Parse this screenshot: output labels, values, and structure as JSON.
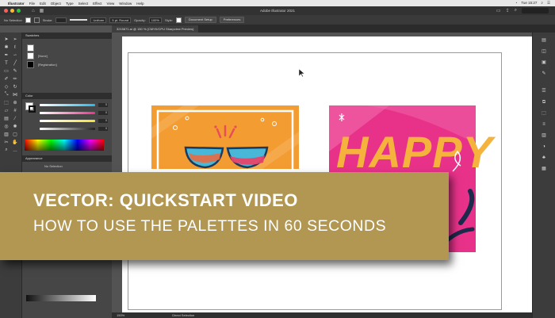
{
  "menubar": {
    "items": [
      "Illustrator",
      "File",
      "Edit",
      "Object",
      "Type",
      "Select",
      "Effect",
      "View",
      "Window",
      "Help"
    ],
    "clock": "Tue 15:27"
  },
  "titlebar": {
    "title": "Adobe Illustrator 2021"
  },
  "controlbar": {
    "selection": "No Selection",
    "stroke_label": "Stroke:",
    "stroke_style": "Uniform",
    "brush": "5 pt. Round",
    "opacity_label": "Opacity:",
    "opacity_value": "100%",
    "style_label": "Style:",
    "doc_setup": "Document Setup",
    "preferences": "Preferences"
  },
  "document": {
    "tab_label": "3215871.ai @ 150 % (CMYK/CPU Sharpview Preview)",
    "zoom": "150%",
    "status_tool": "Direct Selection"
  },
  "panels": {
    "swatches_title": "Swatches",
    "swatches": [
      {
        "label": "[None]",
        "color": "#ffffff"
      },
      {
        "label": "[Registration]",
        "color": "#000000"
      }
    ],
    "color_title": "Color",
    "color_channels": [
      {
        "name": "C",
        "value": "0",
        "color": "#29b7e8"
      },
      {
        "name": "M",
        "value": "0",
        "color": "#e8348c"
      },
      {
        "name": "Y",
        "value": "0",
        "color": "#f2e23a"
      },
      {
        "name": "K",
        "value": "0",
        "color": "#222222"
      }
    ],
    "appearance_title": "Appearance",
    "appearance_status": "No Selection"
  },
  "banner": {
    "headline": "VECTOR: QUICKSTART VIDEO",
    "subline": "HOW TO USE THE PALETTES IN 60 SECONDS",
    "color": "#b19752"
  },
  "artwork": {
    "left_card_bg": "#f39c32",
    "right_card_bg": "#e8328a",
    "right_card_text": "HAPPY"
  }
}
